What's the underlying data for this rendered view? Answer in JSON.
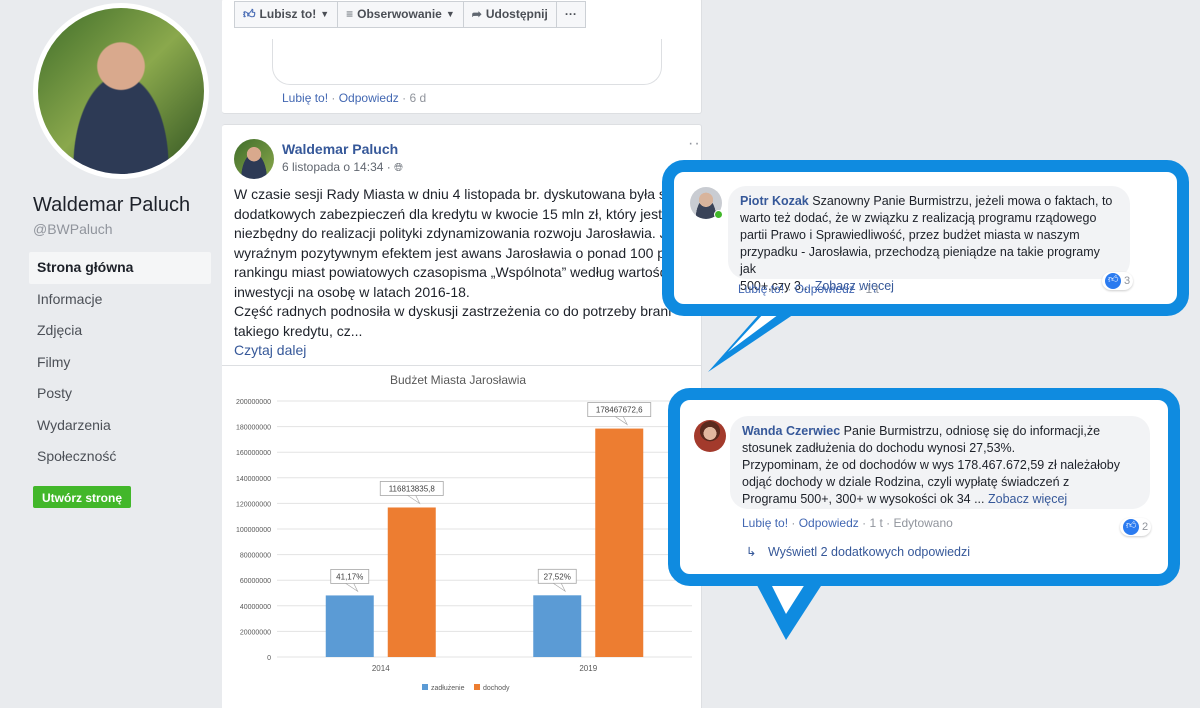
{
  "sidebar": {
    "page_name": "Waldemar Paluch",
    "handle": "@BWPaluch",
    "nav": [
      "Strona główna",
      "Informacje",
      "Zdjęcia",
      "Filmy",
      "Posty",
      "Wydarzenia",
      "Społeczność"
    ],
    "create_page": "Utwórz stronę"
  },
  "top_card": {
    "like_btn": "Lubisz to!",
    "follow_btn": "Obserwowanie",
    "share_btn": "Udostępnij",
    "more_btn": "···",
    "like_link": "Lubię to!",
    "reply_link": "Odpowiedz",
    "age": "6 d"
  },
  "post": {
    "author": "Waldemar Paluch",
    "date": "6 listopada o 14:34 ·",
    "dots": "···",
    "lines": [
      "W czasie sesji Rady Miasta w dniu 4 listopada br. dyskutowana była s",
      "dodatkowych zabezpieczeń dla kredytu w kwocie 15 mln zł, który jest",
      "niezbędny do realizacji polityki zdynamizowania rozwoju Jarosławia. Je",
      "wyraźnym pozytywnym efektem jest awans Jarosławia o ponad 100 po",
      "rankingu miast powiatowych czasopisma „Wspólnota” według wartości",
      "inwestycji na osobę w latach 2016-18.",
      "Część radnych podnosiła w dyskusji zastrzeżenia co do potrzeby brani",
      "takiego kredytu, cz..."
    ],
    "read_more": "Czytaj dalej"
  },
  "chart_data": {
    "type": "bar",
    "title": "Budżet Miasta Jarosławia",
    "categories": [
      "2014",
      "2019"
    ],
    "series": [
      {
        "name": "zadłużenie",
        "values": [
          48100000,
          48200000
        ],
        "labels": [
          "41,17%",
          "27,52%"
        ],
        "color": "#5b9bd5"
      },
      {
        "name": "dochody",
        "values": [
          116813835.8,
          178467672.6
        ],
        "labels": [
          "116813835,8",
          "178467672,6"
        ],
        "color": "#ed7d31"
      }
    ],
    "yticks": [
      "200000000",
      "180000000",
      "160000000",
      "140000000",
      "120000000",
      "100000000",
      "80000000",
      "60000000",
      "40000000",
      "20000000",
      "0"
    ],
    "ylim": [
      0,
      200000000
    ],
    "legend": "bottom",
    "grid": true
  },
  "comment1": {
    "name": "Piotr Kozak",
    "lines": [
      "Szanowny Panie Burmistrzu, jeżeli mowa o faktach, to",
      "warto też dodać, że w związku z realizacją programu rządowego",
      "partii Prawo i Sprawiedliwość, przez budżet miasta w naszym",
      "przypadku - Jarosławia, przechodzą pieniądze na takie programy jak",
      "500+,czy 3..."
    ],
    "more": "Zobacz więcej",
    "reactions": "3",
    "like_link": "Lubię to!",
    "reply_link": "Odpowiedz",
    "age": "1 t"
  },
  "comment2": {
    "name": "Wanda Czerwiec",
    "lines": [
      "Panie Burmistrzu, odniosę się do informacji,że",
      "stosunek zadłużenia do dochodu wynosi 27,53%.",
      "Przypominam, że od dochodów w wys 178.467.672,59 zł należałoby",
      "odjąć dochody w dziale Rodzina, czyli wypłatę świadczeń z",
      "Programu 500+, 300+ w wysokości ok 34 ..."
    ],
    "more": "Zobacz więcej",
    "reactions": "2",
    "like_link": "Lubię to!",
    "reply_link": "Odpowiedz",
    "age": "1 t",
    "edited": "Edytowano",
    "replies": "Wyświetl 2 dodatkowych odpowiedzi"
  }
}
